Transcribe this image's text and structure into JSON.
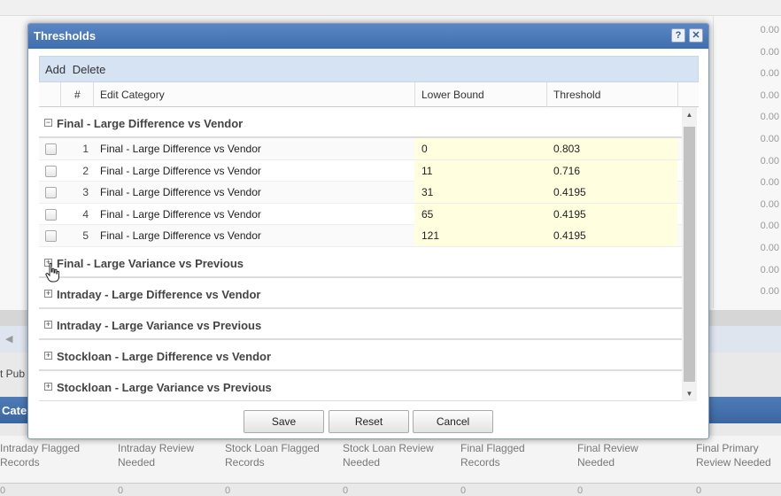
{
  "background": {
    "right_column_values": [
      "0.00",
      "0.00",
      "0.00",
      "0.00",
      "0.00",
      "0.00",
      "0.00",
      "0.00",
      "0.00",
      "0.00",
      "0.00",
      "0.00",
      "0.00"
    ],
    "pub_label": "t Pub",
    "category_header": "Cate",
    "columns": [
      {
        "label": "Intraday Flagged Records",
        "value": "0"
      },
      {
        "label": "Intraday Review Needed",
        "value": "0"
      },
      {
        "label": "Stock Loan Flagged Records",
        "value": "0"
      },
      {
        "label": "Stock Loan Review Needed",
        "value": "0"
      },
      {
        "label": "Final Flagged Records",
        "value": "0"
      },
      {
        "label": "Final Review Needed",
        "value": "0"
      },
      {
        "label": "Final Primary Review Needed",
        "value": "0"
      }
    ]
  },
  "dialog": {
    "title": "Thresholds",
    "help_label": "?",
    "close_label": "✕",
    "toolbar": {
      "add_label": "Add",
      "delete_label": "Delete"
    },
    "columns": {
      "num": "#",
      "edit_category": "Edit Category",
      "lower_bound": "Lower Bound",
      "threshold": "Threshold"
    },
    "groups": [
      {
        "label": "Final - Large Difference vs Vendor",
        "expanded": true,
        "rows": [
          {
            "num": "1",
            "category": "Final - Large Difference vs Vendor",
            "lower_bound": "0",
            "threshold": "0.803"
          },
          {
            "num": "2",
            "category": "Final - Large Difference vs Vendor",
            "lower_bound": "11",
            "threshold": "0.716"
          },
          {
            "num": "3",
            "category": "Final - Large Difference vs Vendor",
            "lower_bound": "31",
            "threshold": "0.4195"
          },
          {
            "num": "4",
            "category": "Final - Large Difference vs Vendor",
            "lower_bound": "65",
            "threshold": "0.4195"
          },
          {
            "num": "5",
            "category": "Final - Large Difference vs Vendor",
            "lower_bound": "121",
            "threshold": "0.4195"
          }
        ]
      },
      {
        "label": "Final - Large Variance vs Previous",
        "expanded": false
      },
      {
        "label": "Intraday - Large Difference vs Vendor",
        "expanded": false
      },
      {
        "label": "Intraday - Large Variance vs Previous",
        "expanded": false
      },
      {
        "label": "Stockloan - Large Difference vs Vendor",
        "expanded": false
      },
      {
        "label": "Stockloan - Large Variance vs Previous",
        "expanded": false
      }
    ],
    "buttons": {
      "save": "Save",
      "reset": "Reset",
      "cancel": "Cancel"
    },
    "colors": {
      "title_bar": "#4a79b8",
      "editable_cell": "#ffffe0",
      "toolbar": "#d6e3f3"
    }
  }
}
